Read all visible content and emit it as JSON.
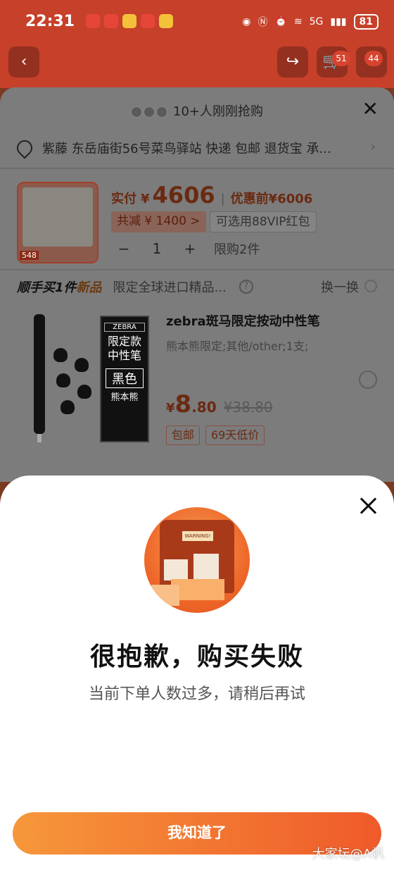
{
  "status_bar": {
    "time": "22:31",
    "network": "5G",
    "battery": "81"
  },
  "top_bar": {
    "back_icon": "back-arrow-icon",
    "share_icon": "share-icon",
    "cart_badge": "51",
    "more_badge": "44"
  },
  "sheet": {
    "header_text": "10+人刚刚抢购",
    "address": "紫藤 东岳庙街56号菜鸟驿站 快递 包邮 退货宝 承...",
    "price": {
      "label": "实付",
      "currency": "¥",
      "amount": "4606",
      "original_label": "优惠前",
      "original": "¥6006",
      "discount_chip": "共减 ¥ 1400 >",
      "vip_chip": "可选用88VIP红包",
      "product_tag": "548"
    },
    "quantity": {
      "minus": "−",
      "value": "1",
      "plus": "+",
      "limit": "限购2件"
    },
    "addon": {
      "title_a": "顺手买1件",
      "title_b": "新品",
      "desc": "限定全球进口精品...",
      "help": "?",
      "swap": "换一换"
    },
    "item": {
      "title": "zebra斑马限定按动中性笔",
      "spec": "熊本熊限定;其他/other;1支;",
      "price_currency": "¥",
      "price_int": "8",
      "price_dec": ".80",
      "old_price": "¥38.80",
      "tags": [
        "包邮",
        "69天低价"
      ],
      "card": {
        "brand": "ZEBRA",
        "name_1": "限定款",
        "name_2": "中性笔",
        "color": "黑色",
        "series": "熊本熊"
      }
    }
  },
  "modal": {
    "illustration_text": "WARNING!",
    "title": "很抱歉，购买失败",
    "message": "当前下单人数过多，请稍后再试",
    "ok_button": "我知道了"
  },
  "watermark": "大家坛@A帆"
}
